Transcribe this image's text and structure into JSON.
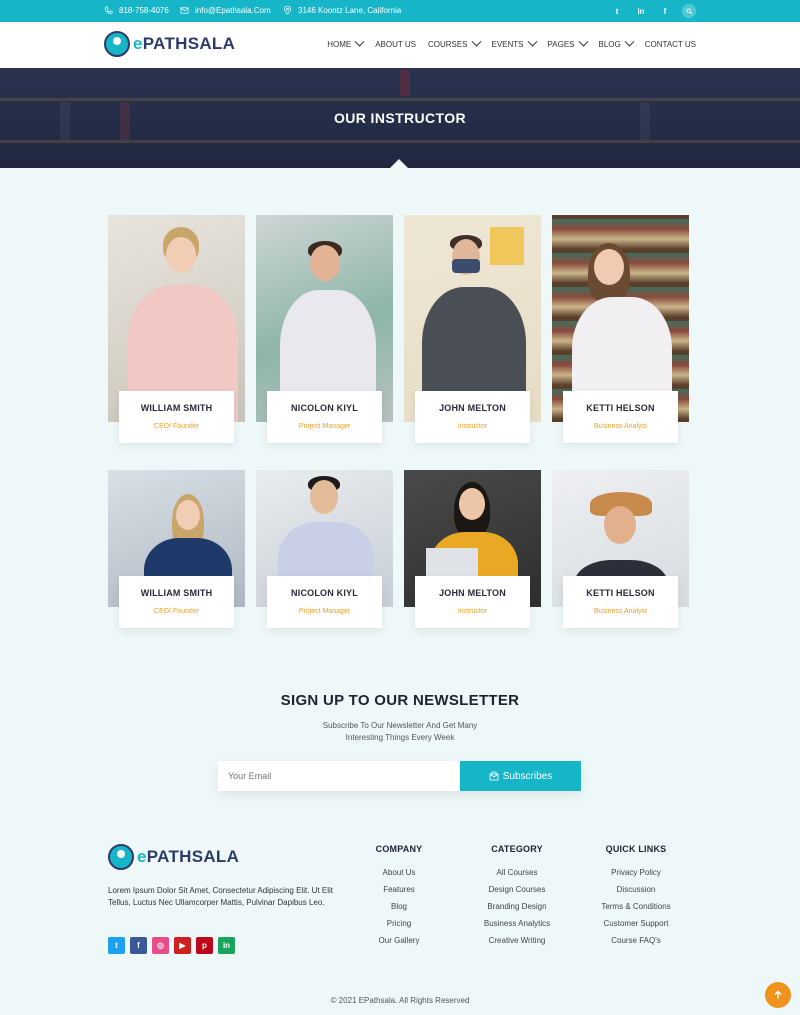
{
  "topbar": {
    "phone": "818-758-4076",
    "email": "info@Epathsala.Com",
    "address": "3146 Koontz Lane, California",
    "social_icons": [
      "twitter-icon",
      "linkedin-icon",
      "facebook-icon",
      "search-icon"
    ]
  },
  "header": {
    "logo_prefix": "e",
    "logo_name": "PATHSALA",
    "nav": [
      {
        "label": "HOME",
        "dropdown": true
      },
      {
        "label": "ABOUT US",
        "dropdown": false
      },
      {
        "label": "COURSES",
        "dropdown": true
      },
      {
        "label": "EVENTS",
        "dropdown": true
      },
      {
        "label": "PAGES",
        "dropdown": true
      },
      {
        "label": "BLOG",
        "dropdown": true
      },
      {
        "label": "CONTACT US",
        "dropdown": false
      }
    ]
  },
  "hero": {
    "title": "OUR INSTRUCTOR"
  },
  "instructors": [
    {
      "name": "WILLIAM SMITH",
      "role": "CEO/ Founder"
    },
    {
      "name": "NICOLON KIYL",
      "role": "Project Manager"
    },
    {
      "name": "JOHN MELTON",
      "role": "Instructor"
    },
    {
      "name": "KETTI HELSON",
      "role": "Business Analyst"
    },
    {
      "name": "WILLIAM SMITH",
      "role": "CEO/ Founder"
    },
    {
      "name": "NICOLON KIYL",
      "role": "Project Manager"
    },
    {
      "name": "JOHN MELTON",
      "role": "Instructor"
    },
    {
      "name": "KETTI HELSON",
      "role": "Business Analyst"
    }
  ],
  "newsletter": {
    "title": "SIGN UP TO OUR NEWSLETTER",
    "subtitle_line1": "Subscribe To Our Newsletter And Get Many",
    "subtitle_line2": "Interesting Things Every Week",
    "placeholder": "Your Email",
    "button": "Subscribes"
  },
  "footer": {
    "logo_prefix": "e",
    "logo_name": "PATHSALA",
    "description": "Lorem Ipsum Dolor Sit Amet, Consectetur Adipiscing Elit. Ut Elit Tellus, Luctus Nec Ullamcorper Mattis, Pulvinar Dapibus Leo.",
    "social_icons": [
      "twitter-icon",
      "facebook-icon",
      "dribbble-icon",
      "youtube-icon",
      "pinterest-icon",
      "linkedin-icon"
    ],
    "columns": [
      {
        "title": "COMPANY",
        "links": [
          "About Us",
          "Features",
          "Blog",
          "Pricing",
          "Our Gallery"
        ]
      },
      {
        "title": "CATEGORY",
        "links": [
          "All Courses",
          "Design Courses",
          "Branding Design",
          "Business Analytics",
          "Creative Writing"
        ]
      },
      {
        "title": "QUICK LINKS",
        "links": [
          "Privacy Policy",
          "Discussion",
          "Terms & Conditions",
          "Customer Support",
          "Course FAQ's"
        ]
      }
    ],
    "copyright": "© 2021 EPathsala. All Rights Reserved"
  },
  "colors": {
    "accent": "#16b6c8",
    "brand_dark": "#2e3a6b",
    "role_orange": "#f0a020",
    "scroll_top": "#f0931e"
  }
}
